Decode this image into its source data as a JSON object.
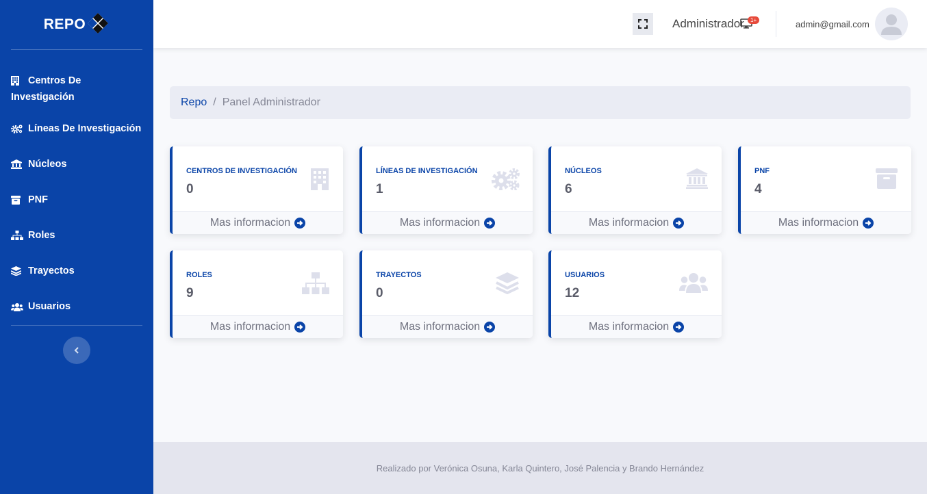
{
  "brand": {
    "name": "REPO"
  },
  "sidebar": {
    "items": [
      {
        "label": "Centros De Investigación",
        "icon": "building-icon"
      },
      {
        "label": "Líneas De Investigación",
        "icon": "cogs-icon"
      },
      {
        "label": "Núcleos",
        "icon": "university-icon"
      },
      {
        "label": "PNF",
        "icon": "archive-icon"
      },
      {
        "label": "Roles",
        "icon": "sitemap-icon"
      },
      {
        "label": "Trayectos",
        "icon": "layer-group-icon"
      },
      {
        "label": "Usuarios",
        "icon": "users-icon"
      }
    ],
    "toggle_icon": "chevron-left-icon"
  },
  "topbar": {
    "role_label": "Administrador",
    "notification_badge": "1+",
    "email": "admin@gmail.com"
  },
  "breadcrumb": {
    "root": "Repo",
    "separator": "/",
    "current": "Panel Administrador"
  },
  "cards": [
    {
      "title": "CENTROS DE INVESTIGACIÓN",
      "count": "0",
      "link": "Mas informacion",
      "icon": "building-icon"
    },
    {
      "title": "LÍNEAS DE INVESTIGACIÓN",
      "count": "1",
      "link": "Mas informacion",
      "icon": "cogs-icon"
    },
    {
      "title": "NÚCLEOS",
      "count": "6",
      "link": "Mas informacion",
      "icon": "university-icon"
    },
    {
      "title": "PNF",
      "count": "4",
      "link": "Mas informacion",
      "icon": "archive-icon"
    },
    {
      "title": "ROLES",
      "count": "9",
      "link": "Mas informacion",
      "icon": "sitemap-icon"
    },
    {
      "title": "TRAYECTOS",
      "count": "0",
      "link": "Mas informacion",
      "icon": "layer-group-icon"
    },
    {
      "title": "USUARIOS",
      "count": "12",
      "link": "Mas informacion",
      "icon": "users-icon"
    }
  ],
  "footer": {
    "credits": "Realizado por Verónica Osuna, Karla Quintero, José Palencia y Brando Hernández"
  },
  "colors": {
    "primary": "#0a44a8",
    "background": "#f8f9fc",
    "footer_bg": "#e4e5ee",
    "badge": "#e74a3b",
    "card_icon": "#dddfeb"
  }
}
